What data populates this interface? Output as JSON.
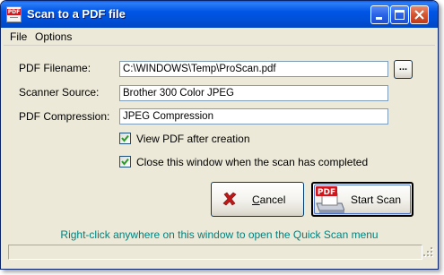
{
  "window": {
    "title": "Scan to a PDF file",
    "app_icon_label": "PDF"
  },
  "titlebar_buttons": {
    "minimize_icon": "minimize-icon",
    "maximize_icon": "maximize-icon",
    "close_icon": "close-icon"
  },
  "menu": {
    "items": [
      {
        "label": "File"
      },
      {
        "label": "Options"
      }
    ]
  },
  "form": {
    "pdf_filename": {
      "label": "PDF Filename:",
      "value": "C:\\WINDOWS\\Temp\\ProScan.pdf",
      "browse_label": "..."
    },
    "scanner_source": {
      "label": "Scanner Source:",
      "value": "Brother 300 Color JPEG"
    },
    "pdf_compression": {
      "label": "PDF Compression:",
      "value": "JPEG Compression"
    }
  },
  "options": {
    "view_pdf": {
      "label": "View PDF after creation",
      "checked": true
    },
    "close_window": {
      "label": "Close this window when the scan has completed",
      "checked": true
    }
  },
  "buttons": {
    "cancel": {
      "label": "Cancel",
      "accelerator": "C",
      "icon": "red-x-icon",
      "icon_color": "#c01818"
    },
    "start_scan": {
      "label": "Start Scan",
      "icon": "pdf-scanner-icon",
      "badge": "PDF",
      "badge_color": "#d3141a"
    }
  },
  "hint": {
    "text": "Right-click anywhere on this window to open the Quick Scan menu",
    "color": "#00817e"
  },
  "status_bar": {
    "text": ""
  }
}
